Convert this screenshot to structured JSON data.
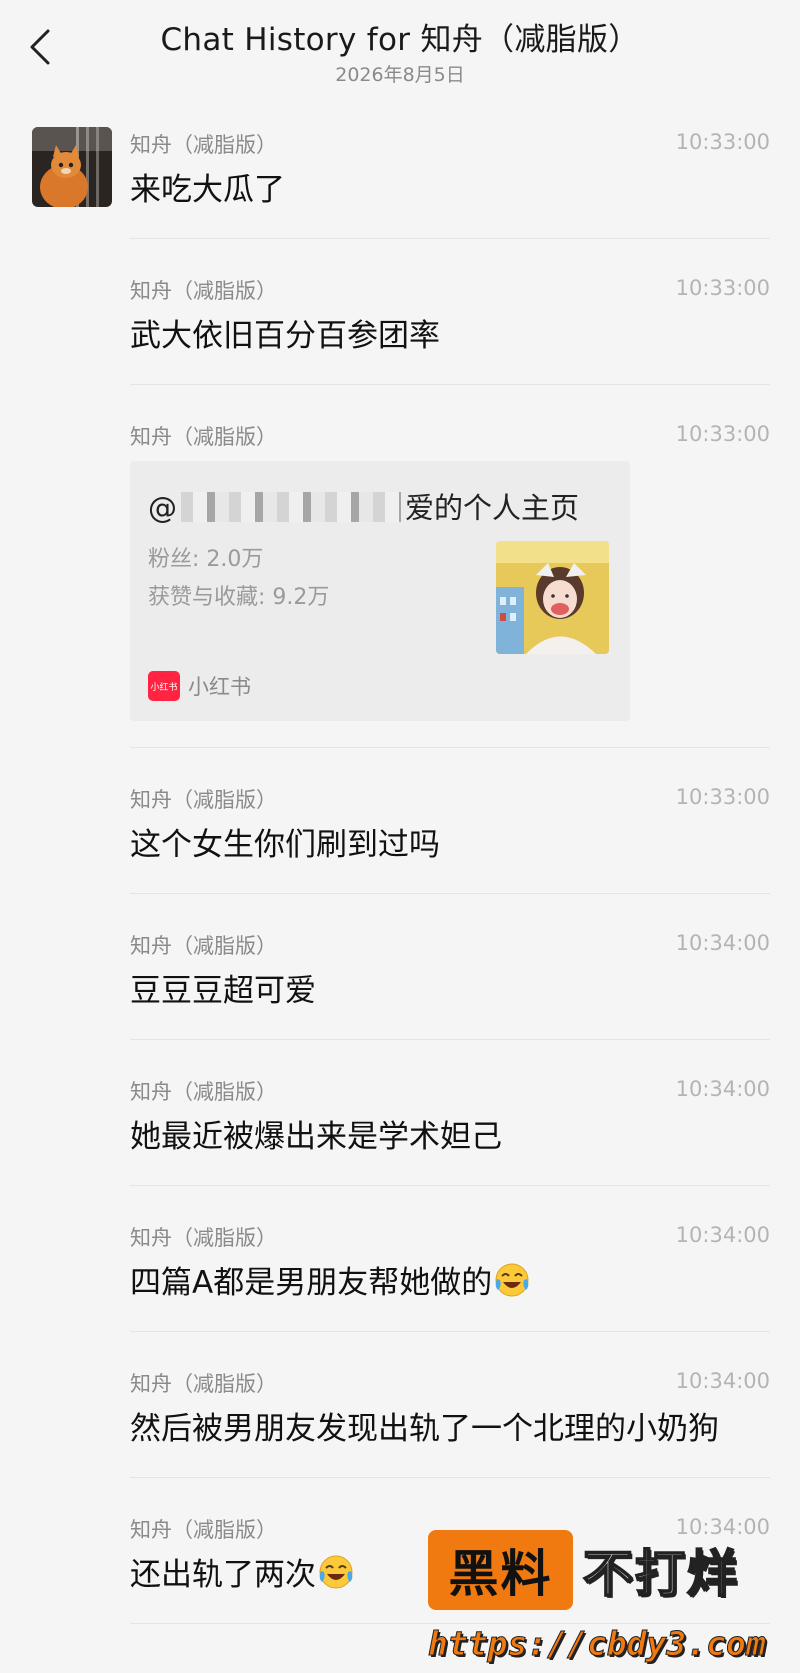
{
  "header": {
    "title": "Chat History for 知舟（减脂版）",
    "date": "2026年8月5日"
  },
  "messages": [
    {
      "sender": "知舟（减脂版）",
      "time": "10:33:00",
      "text": "来吃大瓜了"
    },
    {
      "sender": "知舟（减脂版）",
      "time": "10:33:00",
      "text": "武大依旧百分百参团率"
    },
    {
      "sender": "知舟（减脂版）",
      "time": "10:33:00",
      "card": {
        "title_prefix": "@",
        "title_suffix": "爱的个人主页",
        "followers": "粉丝: 2.0万",
        "likes": "获赞与收藏: 9.2万",
        "app_name": "小红书",
        "app_logo_text": "小红书"
      }
    },
    {
      "sender": "知舟（减脂版）",
      "time": "10:33:00",
      "text": "这个女生你们刷到过吗"
    },
    {
      "sender": "知舟（减脂版）",
      "time": "10:34:00",
      "text": "豆豆豆超可爱"
    },
    {
      "sender": "知舟（减脂版）",
      "time": "10:34:00",
      "text": "她最近被爆出来是学术妲己"
    },
    {
      "sender": "知舟（减脂版）",
      "time": "10:34:00",
      "text": "四篇A都是男朋友帮她做的",
      "emoji": "crying-laughing-emoji"
    },
    {
      "sender": "知舟（减脂版）",
      "time": "10:34:00",
      "text": "然后被男朋友发现出轨了一个北理的小奶狗"
    },
    {
      "sender": "知舟（减脂版）",
      "time": "10:34:00",
      "text": "还出轨了两次",
      "emoji": "crying-laughing-emoji"
    }
  ],
  "watermark": {
    "box_text": "黑料",
    "rest_text": "不打烊",
    "url": "https://cbdy3.com"
  },
  "colors": {
    "background": "#f5f5f5",
    "xhs_red": "#ff2442",
    "watermark_orange": "#f07a10"
  }
}
